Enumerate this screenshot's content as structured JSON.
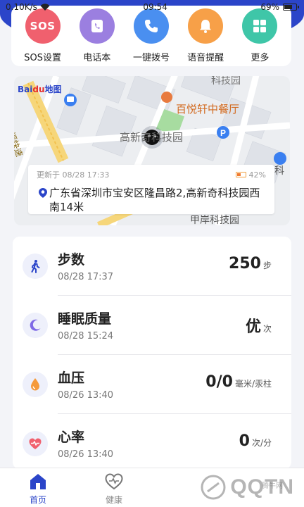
{
  "status_bar": {
    "speed": "0.10K/s",
    "time": "09:54",
    "battery": "69%",
    "battery_level": 0.69
  },
  "quick_actions": [
    {
      "label": "SOS设置",
      "icon": "sos-icon",
      "icon_text": "SOS",
      "color": "#f0606e"
    },
    {
      "label": "电话本",
      "icon": "phonebook-icon",
      "color": "#9b7fe0"
    },
    {
      "label": "一键拨号",
      "icon": "phone-icon",
      "color": "#4a8ff0"
    },
    {
      "label": "语音提醒",
      "icon": "bell-icon",
      "color": "#f7a048"
    },
    {
      "label": "更多",
      "icon": "grid-icon",
      "color": "#3fc6a8"
    }
  ],
  "map": {
    "logo_main": "Bai",
    "logo_du": "du",
    "logo_map": "地图",
    "poi_top": "科技园",
    "poi_restaurant": "百悦轩中餐厅",
    "poi_park": "高新奇科技园",
    "poi_bottom": "甲岸科技园",
    "road_name": "南坪快速",
    "side_char": "科",
    "updated": "更新于 08/28 17:33",
    "battery": "42%",
    "battery_level": 0.42,
    "address": "广东省深圳市宝安区隆昌路2,高新奇科技园西南14米"
  },
  "health": [
    {
      "title": "步数",
      "time": "08/28 17:37",
      "value": "250",
      "unit": "步",
      "icon": "walk-icon",
      "color": "#2b45c9"
    },
    {
      "title": "睡眠质量",
      "time": "08/28 15:24",
      "value": "优",
      "unit": "次",
      "icon": "moon-icon",
      "color": "#7f6ae6"
    },
    {
      "title": "血压",
      "time": "08/26 13:40",
      "value": "0/0",
      "unit": "毫米/汞柱",
      "icon": "drop-icon",
      "color": "#f59a3a"
    },
    {
      "title": "心率",
      "time": "08/26 13:40",
      "value": "0",
      "unit": "次/分",
      "icon": "heart-rate-icon",
      "color": "#f0606e"
    }
  ],
  "nav": [
    {
      "label": "首页",
      "icon": "home-icon",
      "active": true
    },
    {
      "label": "健康",
      "icon": "heart-icon",
      "active": false
    }
  ],
  "watermark": {
    "brand": "QQTN",
    "site": "腾牛网"
  },
  "colors": {
    "primary": "#2b45c9",
    "background": "#f3f4f8"
  }
}
